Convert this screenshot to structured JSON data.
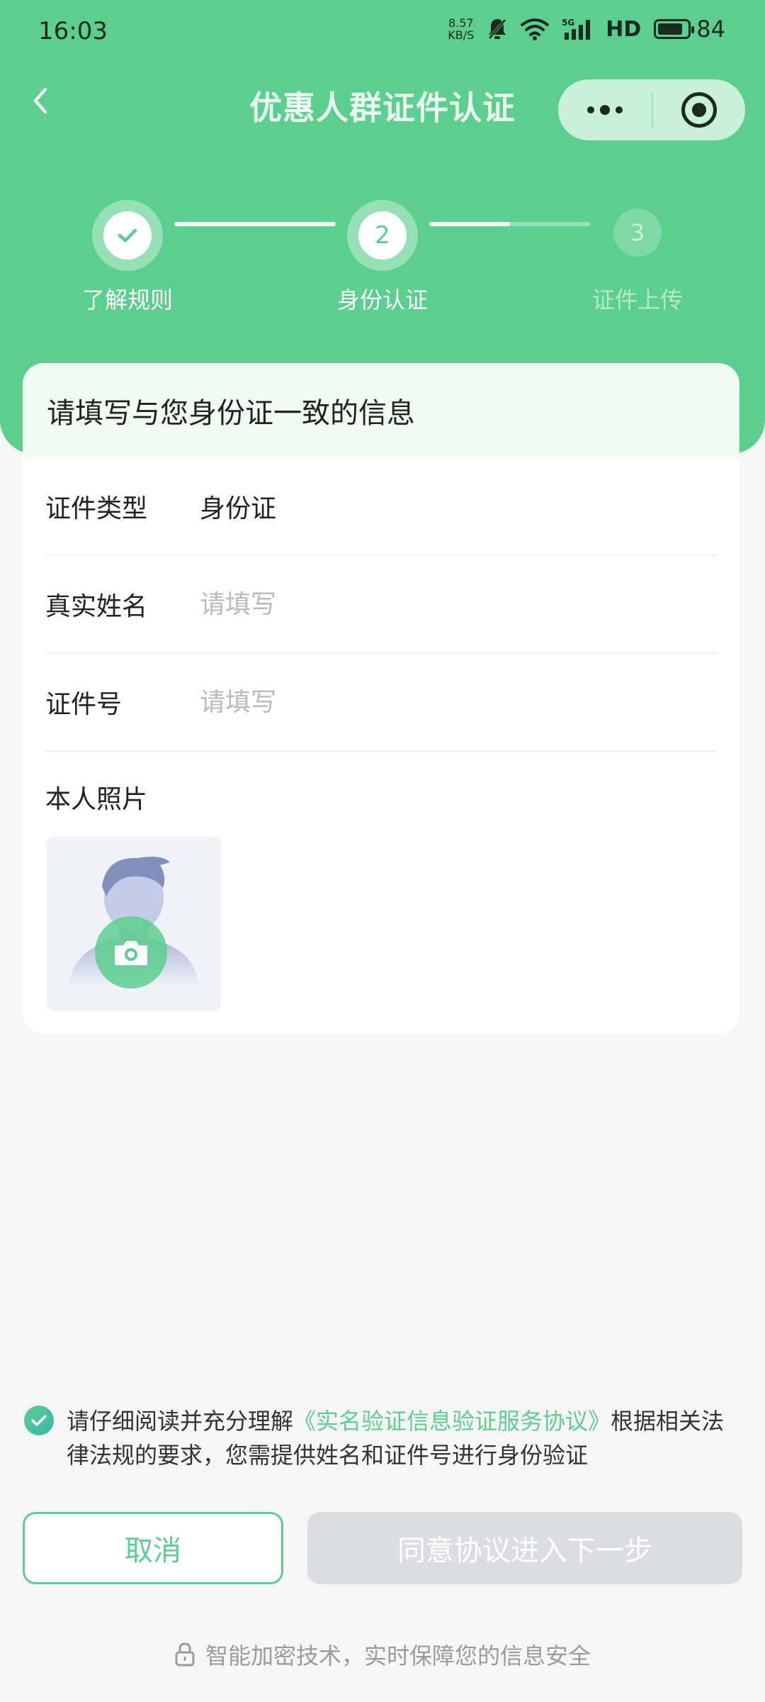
{
  "status_bar": {
    "time": "16:03",
    "net_speed_value": "8.57",
    "net_speed_unit": "KB/S",
    "network": "5G",
    "hd": "HD",
    "battery": "84"
  },
  "nav": {
    "title": "优惠人群证件认证"
  },
  "steps": [
    {
      "number": "",
      "label": "了解规则",
      "state": "done"
    },
    {
      "number": "2",
      "label": "身份认证",
      "state": "active"
    },
    {
      "number": "3",
      "label": "证件上传",
      "state": "pending"
    }
  ],
  "form": {
    "heading": "请填写与您身份证一致的信息",
    "fields": [
      {
        "label": "证件类型",
        "value": "身份证"
      },
      {
        "label": "真实姓名",
        "placeholder": "请填写"
      },
      {
        "label": "证件号",
        "placeholder": "请填写"
      }
    ],
    "photo_label": "本人照片"
  },
  "agreement": {
    "prefix": "请仔细阅读并充分理解",
    "link": "《实名验证信息验证服务协议》",
    "suffix": "根据相关法律法规的要求，您需提供姓名和证件号进行身份验证",
    "checked": true
  },
  "buttons": {
    "cancel": "取消",
    "next": "同意协议进入下一步"
  },
  "footer": {
    "security_note": "智能加密技术，实时保障您的信息安全"
  },
  "colors": {
    "brand_green": "#5ccf8e",
    "disabled_button": "#dcdde0",
    "page_bg": "#f6f6f6"
  }
}
